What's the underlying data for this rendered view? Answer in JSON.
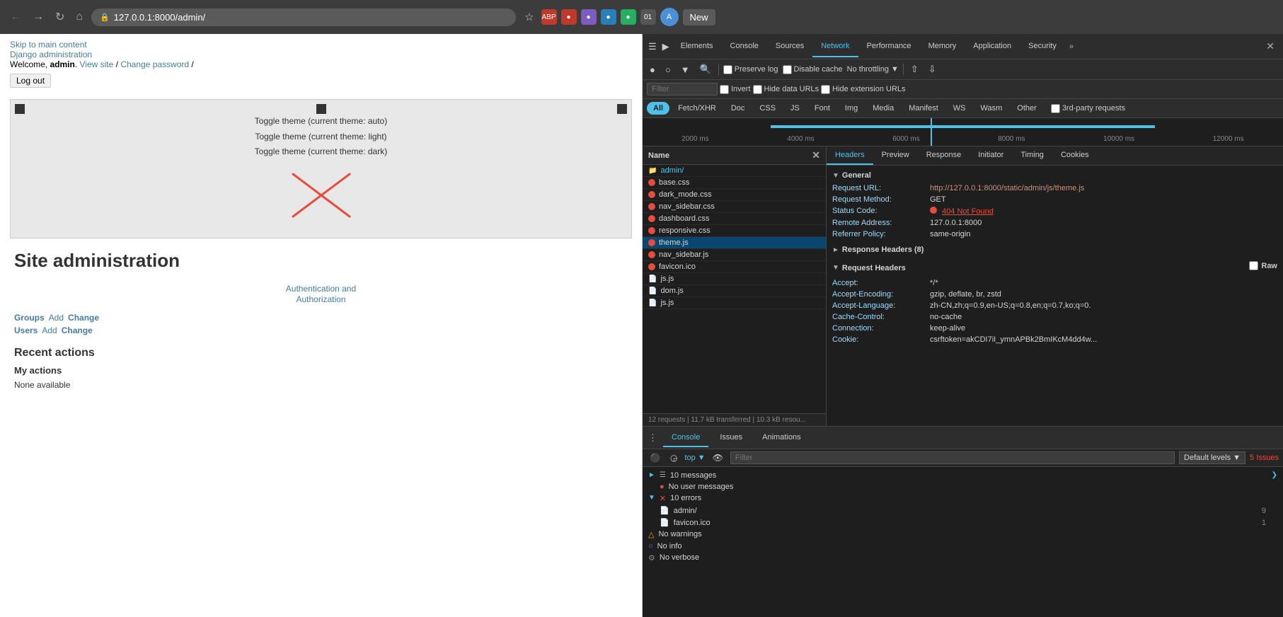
{
  "browser": {
    "back_label": "←",
    "forward_label": "→",
    "reload_label": "↻",
    "home_label": "⌂",
    "url": "127.0.0.1:8000/admin/",
    "star_label": "☆",
    "new_tab_label": "New",
    "profile_label": "A",
    "ext_labels": [
      "ABP",
      "🔴",
      "🔵",
      "🟦",
      "🌐",
      "01"
    ]
  },
  "devtools": {
    "tabs": [
      {
        "label": "Elements",
        "active": false
      },
      {
        "label": "Console",
        "active": false
      },
      {
        "label": "Sources",
        "active": false
      },
      {
        "label": "Network",
        "active": true
      },
      {
        "label": "Performance",
        "active": false
      },
      {
        "label": "Memory",
        "active": false
      },
      {
        "label": "Application",
        "active": false
      },
      {
        "label": "Security",
        "active": false
      }
    ],
    "network": {
      "filter_placeholder": "Filter",
      "toolbar_checkboxes": [
        {
          "label": "Preserve log",
          "checked": false
        },
        {
          "label": "Disable cache",
          "checked": false
        },
        {
          "label": "No throttling",
          "checked": false
        },
        {
          "label": "Hide data URLs",
          "checked": false
        },
        {
          "label": "Hide extension URLs",
          "checked": false
        }
      ],
      "filter_pills": [
        {
          "label": "All",
          "active": true
        },
        {
          "label": "Fetch/XHR",
          "active": false
        },
        {
          "label": "Doc",
          "active": false
        },
        {
          "label": "CSS",
          "active": false
        },
        {
          "label": "JS",
          "active": false
        },
        {
          "label": "Font",
          "active": false
        },
        {
          "label": "Img",
          "active": false
        },
        {
          "label": "Media",
          "active": false
        },
        {
          "label": "Manifest",
          "active": false
        },
        {
          "label": "WS",
          "active": false
        },
        {
          "label": "Wasm",
          "active": false
        },
        {
          "label": "Other",
          "active": false
        }
      ],
      "third_party_label": "3rd-party requests",
      "timeline_labels": [
        "2000 ms",
        "4000 ms",
        "6000 ms",
        "8000 ms",
        "10000 ms",
        "12000 ms"
      ],
      "status_bar": "12 requests  |  11.7 kB transferred  |  10.3 kB resou...",
      "name_column": "Name",
      "name_items": [
        {
          "name": "admin/",
          "type": "folder",
          "error": false
        },
        {
          "name": "base.css",
          "type": "file",
          "error": true
        },
        {
          "name": "dark_mode.css",
          "type": "file",
          "error": true
        },
        {
          "name": "nav_sidebar.css",
          "type": "file",
          "error": true
        },
        {
          "name": "dashboard.css",
          "type": "file",
          "error": true
        },
        {
          "name": "responsive.css",
          "type": "file",
          "error": true
        },
        {
          "name": "theme.js",
          "type": "file",
          "error": true,
          "selected": true
        },
        {
          "name": "nav_sidebar.js",
          "type": "file",
          "error": true
        },
        {
          "name": "favicon.ico",
          "type": "file",
          "error": true
        },
        {
          "name": "js.js",
          "type": "file",
          "error": false
        },
        {
          "name": "dom.js",
          "type": "file",
          "error": false
        },
        {
          "name": "js.js",
          "type": "file",
          "error": false
        }
      ]
    },
    "headers": {
      "tabs": [
        "Headers",
        "Preview",
        "Response",
        "Initiator",
        "Timing",
        "Cookies"
      ],
      "active_tab": "Headers",
      "general_section": "General",
      "general": {
        "request_url_label": "Request URL:",
        "request_url_value": "http://127.0.0.1:8000/static/admin/js/theme.js",
        "request_method_label": "Request Method:",
        "request_method_value": "GET",
        "status_code_label": "Status Code:",
        "status_code_value": "404 Not Found",
        "remote_address_label": "Remote Address:",
        "remote_address_value": "127.0.0.1:8000",
        "referrer_policy_label": "Referrer Policy:",
        "referrer_policy_value": "same-origin"
      },
      "response_headers_section": "Response Headers (8)",
      "raw_label": "Raw",
      "request_headers_section": "Request Headers",
      "request_headers": [
        {
          "key": "Accept:",
          "value": "*/*"
        },
        {
          "key": "Accept-Encoding:",
          "value": "gzip, deflate, br, zstd"
        },
        {
          "key": "Accept-Language:",
          "value": "zh-CN,zh;q=0.9,en-US;q=0.8,en;q=0.7,ko;q=0."
        },
        {
          "key": "Cache-Control:",
          "value": "no-cache"
        },
        {
          "key": "Connection:",
          "value": "keep-alive"
        },
        {
          "key": "Cookie:",
          "value": "csrftoken=akCDI7iI_ymnAPBk2BmIKcM4dd4w..."
        }
      ]
    },
    "console": {
      "tabs": [
        {
          "label": "Console",
          "active": true
        },
        {
          "label": "Issues",
          "active": false
        },
        {
          "label": "Animations",
          "active": false
        }
      ],
      "context_label": "top",
      "filter_placeholder": "Filter",
      "default_levels_label": "Default levels ▾",
      "issues_count_label": "5 Issues",
      "items": [
        {
          "type": "expand",
          "label": "10 messages",
          "expanded": true
        },
        {
          "type": "sub-info",
          "icon": "circle",
          "label": "No user messages"
        },
        {
          "type": "expand-error",
          "label": "10 errors",
          "expanded": true
        },
        {
          "type": "sub-file",
          "icon": "file",
          "label": "admin/",
          "count": "9"
        },
        {
          "type": "sub-file",
          "icon": "file",
          "label": "favicon.ico",
          "count": "1"
        },
        {
          "type": "warning",
          "label": "No warnings"
        },
        {
          "type": "info",
          "label": "No info"
        },
        {
          "type": "verbose",
          "label": "No verbose"
        }
      ]
    }
  },
  "django": {
    "skip_link": "Skip to main content",
    "admin_link": "Django administration",
    "welcome_text": "Welcome,",
    "admin_name": "admin",
    "view_site_link": "View site",
    "change_password_link": "Change password",
    "logout_button": "Log out",
    "theme_toggle_1": "Toggle theme (current theme: auto)",
    "theme_toggle_2": "Toggle theme (current theme: light)",
    "theme_toggle_3": "Toggle theme (current theme: dark)",
    "site_admin_title": "Site administration",
    "auth_section_link": "Authentication and\nAuthorization",
    "groups_label": "Groups",
    "groups_add": "Add",
    "groups_change": "Change",
    "users_label": "Users",
    "users_add": "Add",
    "users_change": "Change",
    "recent_actions_title": "Recent actions",
    "my_actions_title": "My actions",
    "none_available": "None available"
  }
}
